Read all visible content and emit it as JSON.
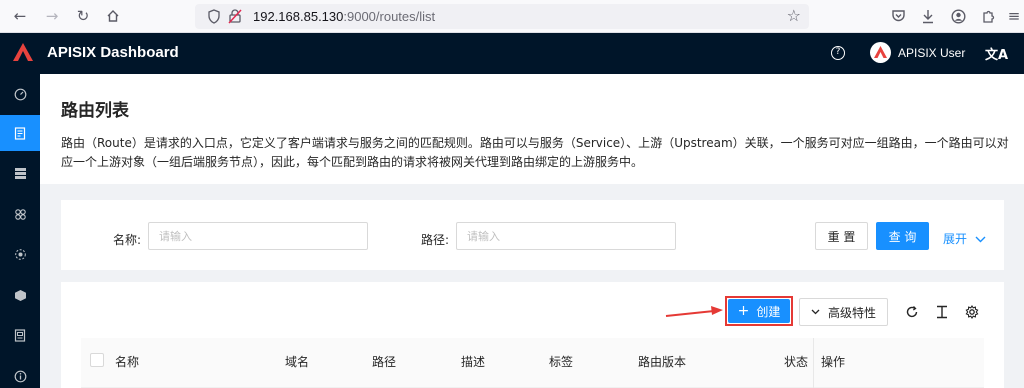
{
  "browser": {
    "url_host": "192.168.85.130",
    "url_rest": ":9000/routes/list"
  },
  "header": {
    "title": "APISIX Dashboard",
    "user_name": "APISIX User",
    "help_glyph": "?",
    "lang_glyph": "文A"
  },
  "sidebar": {
    "items": [
      {
        "icon": "dashboard-icon",
        "active": false
      },
      {
        "icon": "route-icon",
        "active": true
      },
      {
        "icon": "upstream-icon",
        "active": false
      },
      {
        "icon": "service-icon",
        "active": false
      },
      {
        "icon": "consumer-icon",
        "active": false
      },
      {
        "icon": "plugin-icon",
        "active": false
      },
      {
        "icon": "ssl-icon",
        "active": false
      },
      {
        "icon": "info-icon",
        "active": false
      }
    ]
  },
  "page": {
    "title": "路由列表",
    "description": "路由（Route）是请求的入口点，它定义了客户端请求与服务之间的匹配规则。路由可以与服务（Service）、上游（Upstream）关联，一个服务可对应一组路由，一个路由可以对应一个上游对象（一组后端服务节点），因此，每个匹配到路由的请求将被网关代理到路由绑定的上游服务中。"
  },
  "search": {
    "name_label": "名称:",
    "name_placeholder": "请输入",
    "path_label": "路径:",
    "path_placeholder": "请输入",
    "reset_label": "重 置",
    "query_label": "查 询",
    "expand_label": "展开"
  },
  "toolbar": {
    "create_label": "创建",
    "advanced_label": "高级特性"
  },
  "table": {
    "columns": [
      "名称",
      "域名",
      "路径",
      "描述",
      "标签",
      "路由版本",
      "状态",
      "操作"
    ]
  },
  "colors": {
    "primary": "#1890ff",
    "header_bg": "#001529",
    "highlight": "#e53935"
  }
}
